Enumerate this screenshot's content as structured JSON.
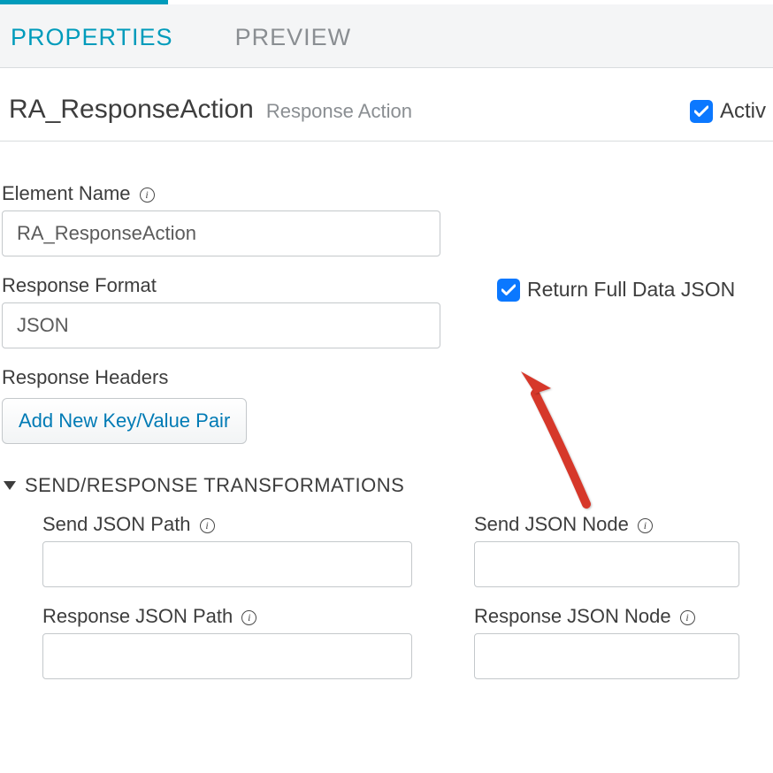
{
  "tabs": {
    "properties": "PROPERTIES",
    "preview": "PREVIEW"
  },
  "header": {
    "title": "RA_ResponseAction",
    "subtitle": "Response Action",
    "active_label": "Activ"
  },
  "form": {
    "element_name_label": "Element Name",
    "element_name_value": "RA_ResponseAction",
    "response_format_label": "Response Format",
    "response_format_value": "JSON",
    "response_headers_label": "Response Headers",
    "add_kv_button": "Add New Key/Value Pair",
    "return_full_label": "Return Full Data JSON"
  },
  "transform": {
    "section_label": "SEND/RESPONSE TRANSFORMATIONS",
    "send_json_path_label": "Send JSON Path",
    "response_json_path_label": "Response JSON Path",
    "send_json_node_label": "Send JSON Node",
    "response_json_node_label": "Response JSON Node"
  }
}
